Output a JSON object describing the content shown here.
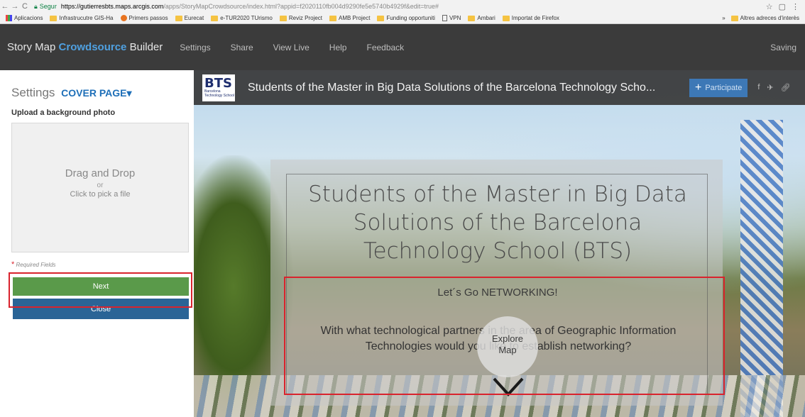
{
  "browser": {
    "secure_label": "Segur",
    "url_host": "https://gutierresbts.maps.arcgis.com",
    "url_path": "/apps/StoryMapCrowdsource/index.html?appid=f2020110fb004d9290fe5e5740b4929f&edit=true#",
    "bookmarks": [
      "Aplicacions",
      "Infrastrucutre GIS-Ha",
      "Primers passos",
      "Eurecat",
      "e-TUR2020 TUrismo",
      "Reviz Project",
      "AMB Project",
      "Funding opportuniti",
      "VPN",
      "Ambari",
      "Importat de Firefox"
    ],
    "bookmarks_more": "»",
    "bookmark_other": "Altres adreces d'interès"
  },
  "header": {
    "title_prefix": "Story Map",
    "title_accent": "Crowdsource",
    "title_suffix": "Builder",
    "nav": [
      "Settings",
      "Share",
      "View Live",
      "Help",
      "Feedback"
    ],
    "status": "Saving"
  },
  "sidebar": {
    "settings_label": "Settings",
    "section": "COVER PAGE",
    "upload_label": "Upload a background photo",
    "drop_main": "Drag and Drop",
    "drop_or": "or",
    "drop_pick": "Click to pick a file",
    "required": "Required Fields",
    "next_label": "Next",
    "close_label": "Close"
  },
  "preview": {
    "logo_big": "BTS",
    "logo_small_1": "Barcelona",
    "logo_small_2": "Technology School",
    "title": "Students of the Master in Big Data Solutions of the Barcelona Technology Scho...",
    "participate_label": "Participate",
    "cover_title": "Students of the Master in Big Data Solutions of the Barcelona Technology School (BTS)",
    "cover_subtitle": "Let´s Go NETWORKING!",
    "cover_question": "With what technological partners in the area of Geographic Information Technologies would you like to establish networking?",
    "explore_line1": "Explore",
    "explore_line2": "Map"
  },
  "colors": {
    "header_bg": "#3b3b3b",
    "accent": "#4fa0e0",
    "next_button": "#5a9a4a",
    "close_button": "#2a6496",
    "highlight": "#d9232d"
  }
}
